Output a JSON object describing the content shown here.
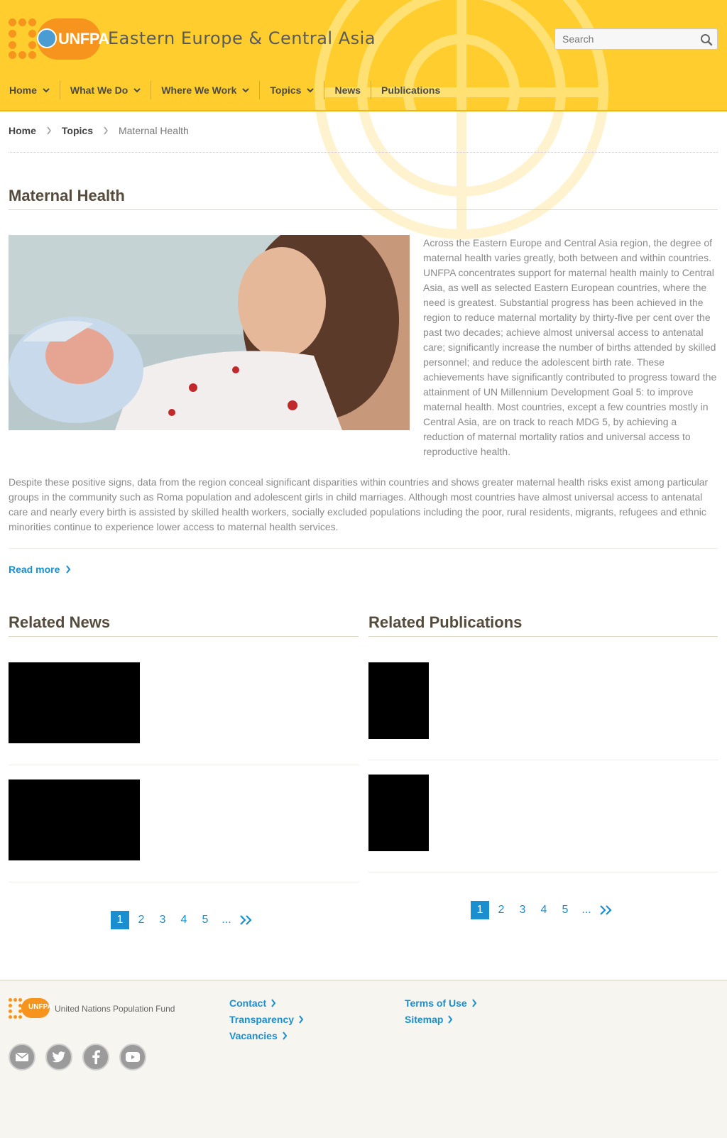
{
  "header": {
    "logo_text": "UNFPA",
    "site_title": "Eastern Europe & Central Asia",
    "search_placeholder": "Search"
  },
  "nav": {
    "items": [
      {
        "label": "Home",
        "has_dropdown": true
      },
      {
        "label": "What We Do",
        "has_dropdown": true
      },
      {
        "label": "Where We Work",
        "has_dropdown": true
      },
      {
        "label": "Topics",
        "has_dropdown": true
      },
      {
        "label": "News",
        "has_dropdown": false
      },
      {
        "label": "Publications",
        "has_dropdown": false
      }
    ]
  },
  "breadcrumb": {
    "home": "Home",
    "topics": "Topics",
    "current": "Maternal Health"
  },
  "page": {
    "title": "Maternal Health",
    "intro": "Across the Eastern Europe and Central Asia region, the degree of maternal health varies greatly, both between and within countries. UNFPA concentrates support for maternal health mainly to Central Asia, as well as selected Eastern European countries, where the need is greatest. Substantial progress has been achieved in the region to reduce maternal mortality by thirty-five per cent over the past two decades; achieve almost universal access to antenatal care; significantly increase the number of births attended by skilled personnel; and reduce the adolescent birth rate. These achievements have significantly contributed to progress toward the attainment of UN Millennium Development Goal 5: to improve maternal health. Most countries, except a few countries mostly in Central Asia, are on track to reach MDG 5, by achieving a reduction of maternal mortality ratios and universal access to reproductive health.",
    "body": "Despite these positive signs, data from the region conceal significant disparities within countries and shows greater maternal health risks exist among particular groups in the community such as Roma population and adolescent girls in child marriages. Although most countries have almost universal access to antenatal care and nearly every birth is assisted by skilled health workers, socially excluded populations including the poor, rural residents, migrants, refugees and ethnic minorities continue to experience lower access to maternal health services.",
    "read_more": "Read more"
  },
  "related_news": {
    "title": "Related News",
    "pagination": {
      "pages": [
        "1",
        "2",
        "3",
        "4",
        "5"
      ],
      "ellipsis": "...",
      "active": "1"
    }
  },
  "related_publications": {
    "title": "Related Publications",
    "pagination": {
      "pages": [
        "1",
        "2",
        "3",
        "4",
        "5"
      ],
      "ellipsis": "...",
      "active": "1"
    }
  },
  "footer": {
    "logo_text": "UNFPA",
    "org_name": "United Nations Population Fund",
    "links_col1": [
      "Contact",
      "Transparency",
      "Vacancies"
    ],
    "links_col2": [
      "Terms of Use",
      "Sitemap"
    ],
    "socials": [
      "email-icon",
      "twitter-icon",
      "facebook-icon",
      "youtube-icon"
    ]
  },
  "colors": {
    "header_bg": "#ffce2e",
    "accent_orange": "#f7941d",
    "link_blue": "#1a8ecf",
    "heading_brown": "#554b3d",
    "footer_bg": "#f6f5ef"
  }
}
